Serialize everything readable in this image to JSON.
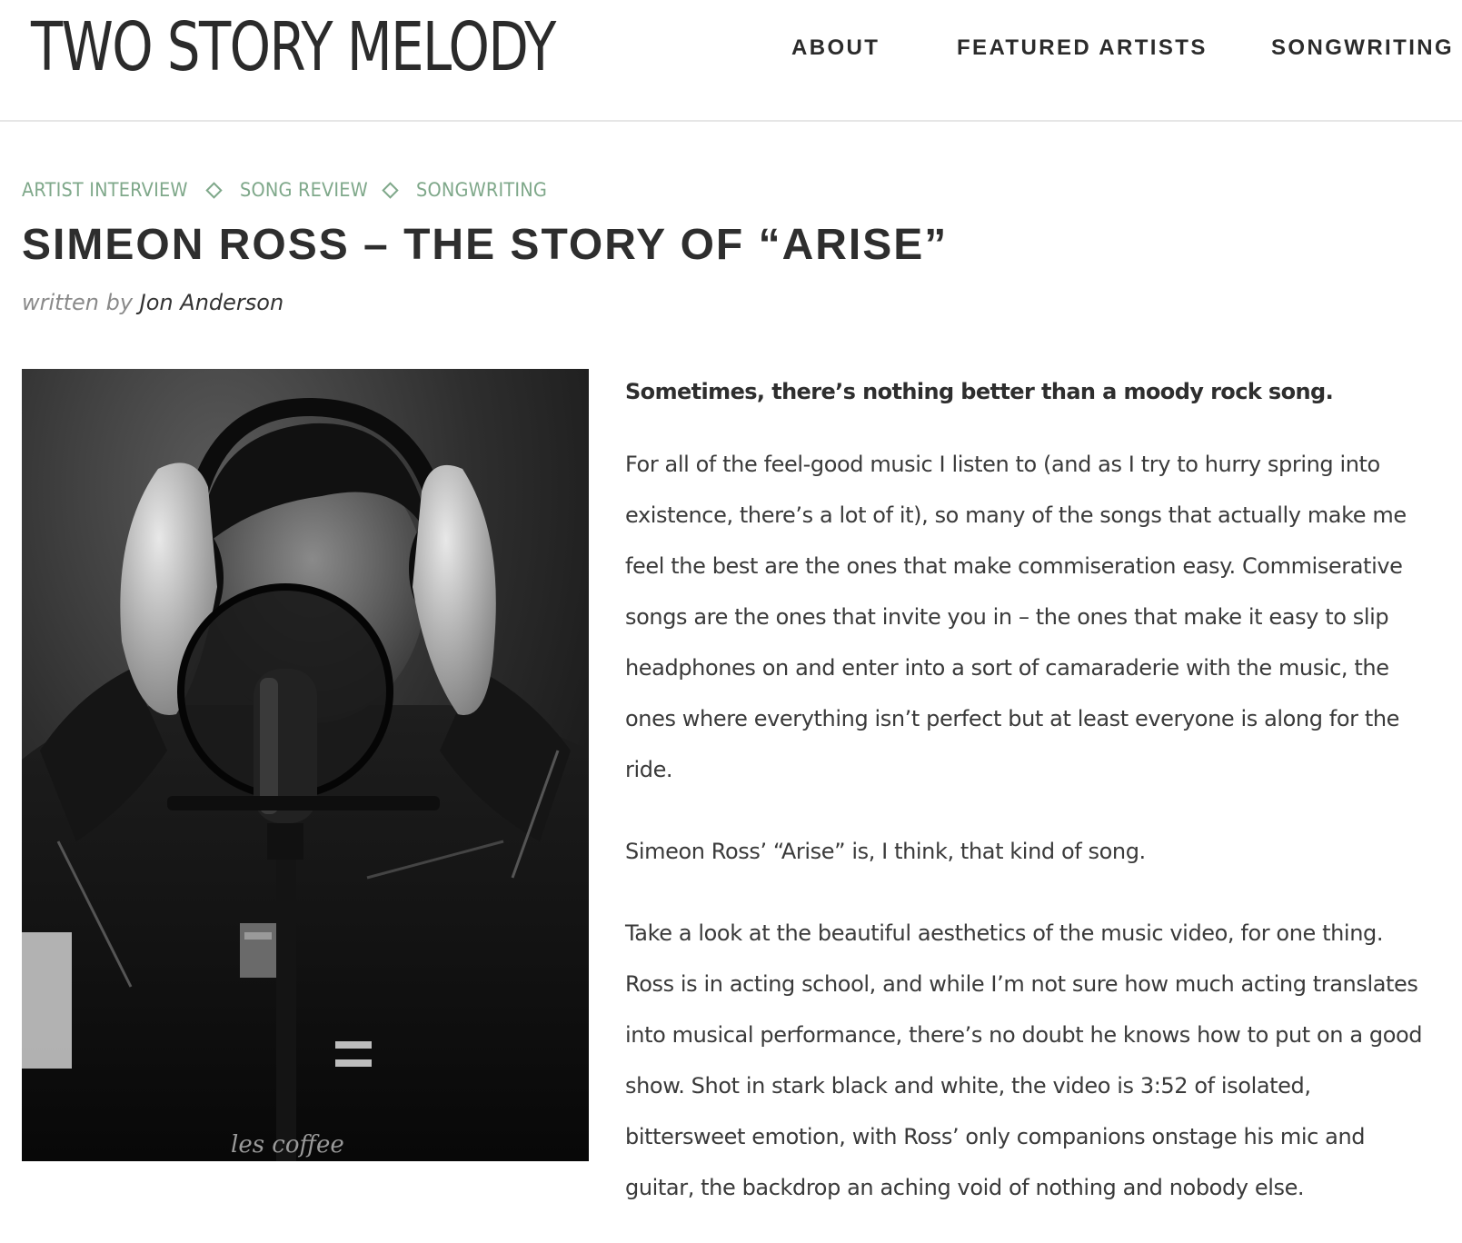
{
  "header": {
    "logo": "TWO STORY MELODY",
    "nav": [
      "ABOUT",
      "FEATURED ARTISTS",
      "SONGWRITING"
    ]
  },
  "post": {
    "categories": [
      "ARTIST INTERVIEW",
      "SONG REVIEW",
      "SONGWRITING"
    ],
    "title": "SIMEON ROSS – THE STORY OF “ARISE”",
    "byline_prefix": "written by",
    "author": "Jon Anderson",
    "lead": "Sometimes, there’s nothing better than a moody rock song.",
    "paragraphs": [
      [
        "For all of the feel-good music I listen to (and as I try to hurry spring into",
        "existence, there’s a lot of it), so many of the songs that actually make me",
        "feel the best are the ones that make commiseration easy. Commiserative",
        "songs are the ones that invite you in – the ones that make it easy to slip",
        "headphones on and enter into a sort of camaraderie with the music, the",
        "ones where everything isn’t perfect but at least everyone is along for the",
        "ride."
      ],
      [
        "Simeon Ross’ “Arise” is, I think, that kind of song."
      ],
      [
        "Take a look at the beautiful aesthetics of the music video, for one thing.",
        "Ross is in acting school, and while I’m not sure how much acting translates",
        "into musical performance, there’s no doubt he knows how to put on a good",
        "show. Shot in stark black and white, the video is 3:52 of isolated,",
        "bittersweet emotion, with Ross’ only companions onstage his mic and",
        "guitar, the backdrop an aching void of nothing and nobody else."
      ]
    ],
    "photo_caption_text": "les coffee"
  },
  "colors": {
    "accent_green": "#7fa88a",
    "text_dark": "#2e2e2e",
    "divider": "#e6e6e6"
  }
}
